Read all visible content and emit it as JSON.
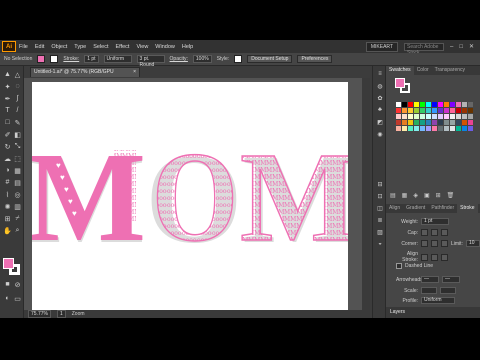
{
  "app": {
    "logo": "Ai",
    "menu": [
      "File",
      "Edit",
      "Object",
      "Type",
      "Select",
      "Effect",
      "View",
      "Window",
      "Help"
    ],
    "workspace": "MIKEART",
    "search_placeholder": "Search Adobe Stock",
    "window_buttons": [
      "–",
      "□",
      "✕"
    ]
  },
  "control": {
    "selection": "No Selection",
    "stroke_label": "Stroke:",
    "stroke_value": "1 pt",
    "stroke_style": "Uniform",
    "brush": "3 pt. Round",
    "opacity_label": "Opacity:",
    "opacity_value": "100%",
    "style_label": "Style:",
    "doc_setup": "Document Setup",
    "preferences": "Preferences",
    "fill_color": "#ee70b3"
  },
  "document": {
    "tab_title": "Untitled-1.ai* @ 75.77% (RGB/GPU Preview)",
    "close": "×"
  },
  "canvas": {
    "headline": "MOM",
    "text_color": "#ee70b3",
    "pattern_m": "MMMMM",
    "pattern_o": "ooooo"
  },
  "status": {
    "zoom": "75.77%",
    "artboard": "1",
    "tool": "Zoom"
  },
  "panels": {
    "swatches_tabs": [
      "Swatches",
      "Color",
      "Transparency"
    ],
    "stroke_tabs": [
      "Align",
      "Gradient",
      "Pathfinder",
      "Stroke"
    ],
    "weight_label": "Weight:",
    "weight_value": "1 pt",
    "cap_label": "Cap:",
    "corner_label": "Corner:",
    "limit_label": "Limit:",
    "limit_value": "10",
    "align_stroke_label": "Align Stroke:",
    "dashed_line": "Dashed Line",
    "arrowheads_label": "Arrowheads:",
    "scale_label": "Scale:",
    "align_label": "Align:",
    "profile_label": "Profile:",
    "profile_value": "Uniform",
    "layers_tab": "Layers",
    "swatch_colors": [
      "#ffffff",
      "#000000",
      "#ff0000",
      "#ffff00",
      "#00ff00",
      "#00ffff",
      "#0000ff",
      "#ff00ff",
      "#ff7f00",
      "#7f00ff",
      "#ee70b3",
      "#b3b3b3",
      "#666666",
      "#ff3333",
      "#ff9933",
      "#ffcc33",
      "#99cc33",
      "#33cc66",
      "#33cccc",
      "#3399ff",
      "#6633cc",
      "#cc33cc",
      "#ff6699",
      "#cc0000",
      "#993300",
      "#663300",
      "#ffcccc",
      "#ffe0cc",
      "#ffffcc",
      "#e0ffcc",
      "#ccffe0",
      "#ccffff",
      "#cce0ff",
      "#e0ccff",
      "#ffccff",
      "#f2f2f2",
      "#d9d9d9",
      "#bfbfbf",
      "#a6a6a6",
      "#c0392b",
      "#e67e22",
      "#f1c40f",
      "#27ae60",
      "#16a085",
      "#2980b9",
      "#8e44ad",
      "#2c3e50",
      "#7f8c8d",
      "#95a5a6",
      "#34495e",
      "#d35400",
      "#e84393",
      "#fab1a0",
      "#ffeaa7",
      "#55efc4",
      "#81ecec",
      "#74b9ff",
      "#a29bfe",
      "#fd79a8",
      "#636e72",
      "#b2bec3",
      "#dfe6e9",
      "#00b894",
      "#0984e3",
      "#6c5ce7"
    ]
  }
}
